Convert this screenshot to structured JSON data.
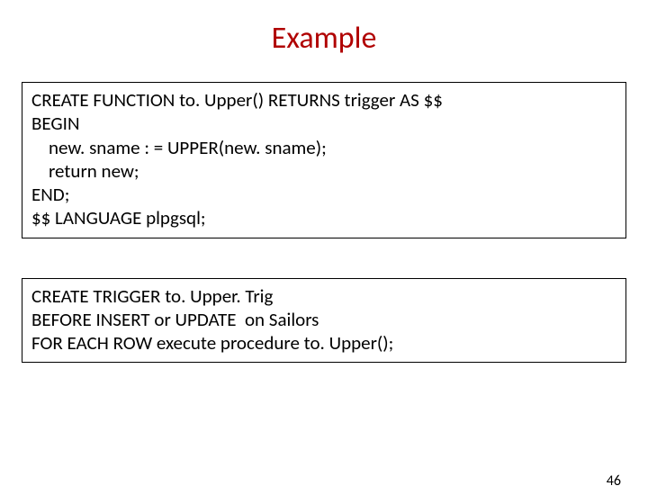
{
  "title": "Example",
  "box1": {
    "l1": "CREATE FUNCTION to. Upper() RETURNS trigger AS $$",
    "l2": "BEGIN",
    "l3": "    new. sname : = UPPER(new. sname);",
    "l4": "    return new;",
    "l5": "END;",
    "l6": "$$ LANGUAGE plpgsql;"
  },
  "box2": {
    "l1": "CREATE TRIGGER to. Upper. Trig",
    "l2": "BEFORE INSERT or UPDATE  on Sailors",
    "l3": "FOR EACH ROW execute procedure to. Upper();"
  },
  "page_number": "46"
}
